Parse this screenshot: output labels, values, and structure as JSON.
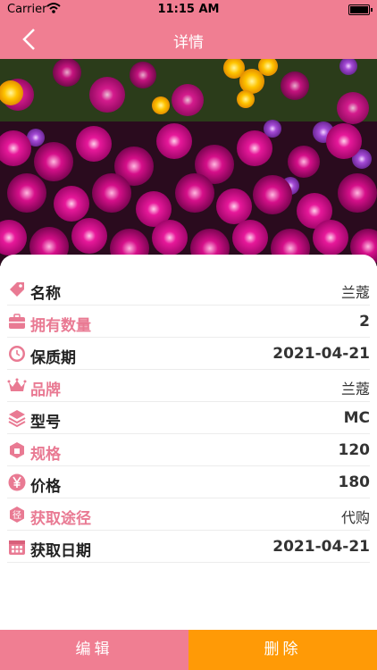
{
  "status": {
    "carrier": "Carrier",
    "time": "11:15 AM"
  },
  "nav": {
    "title": "详情"
  },
  "details": [
    {
      "label": "名称",
      "value": "兰蔻",
      "icon": "tag-icon"
    },
    {
      "label": "拥有数量",
      "value": "2",
      "icon": "briefcase-icon"
    },
    {
      "label": "保质期",
      "value": "2021-04-21",
      "icon": "clock-icon"
    },
    {
      "label": "品牌",
      "value": "兰蔻",
      "icon": "crown-icon"
    },
    {
      "label": "型号",
      "value": "MC",
      "icon": "layers-icon"
    },
    {
      "label": "规格",
      "value": "120",
      "icon": "box-icon"
    },
    {
      "label": "价格",
      "value": "180",
      "icon": "yen-icon"
    },
    {
      "label": "获取途径",
      "value": "代购",
      "icon": "path-icon"
    },
    {
      "label": "获取日期",
      "value": "2021-04-21",
      "icon": "calendar-icon"
    }
  ],
  "footer": {
    "edit_label": "编辑",
    "delete_label": "删除"
  },
  "colors": {
    "primary": "#f07e92",
    "accent": "#ff9a06"
  }
}
